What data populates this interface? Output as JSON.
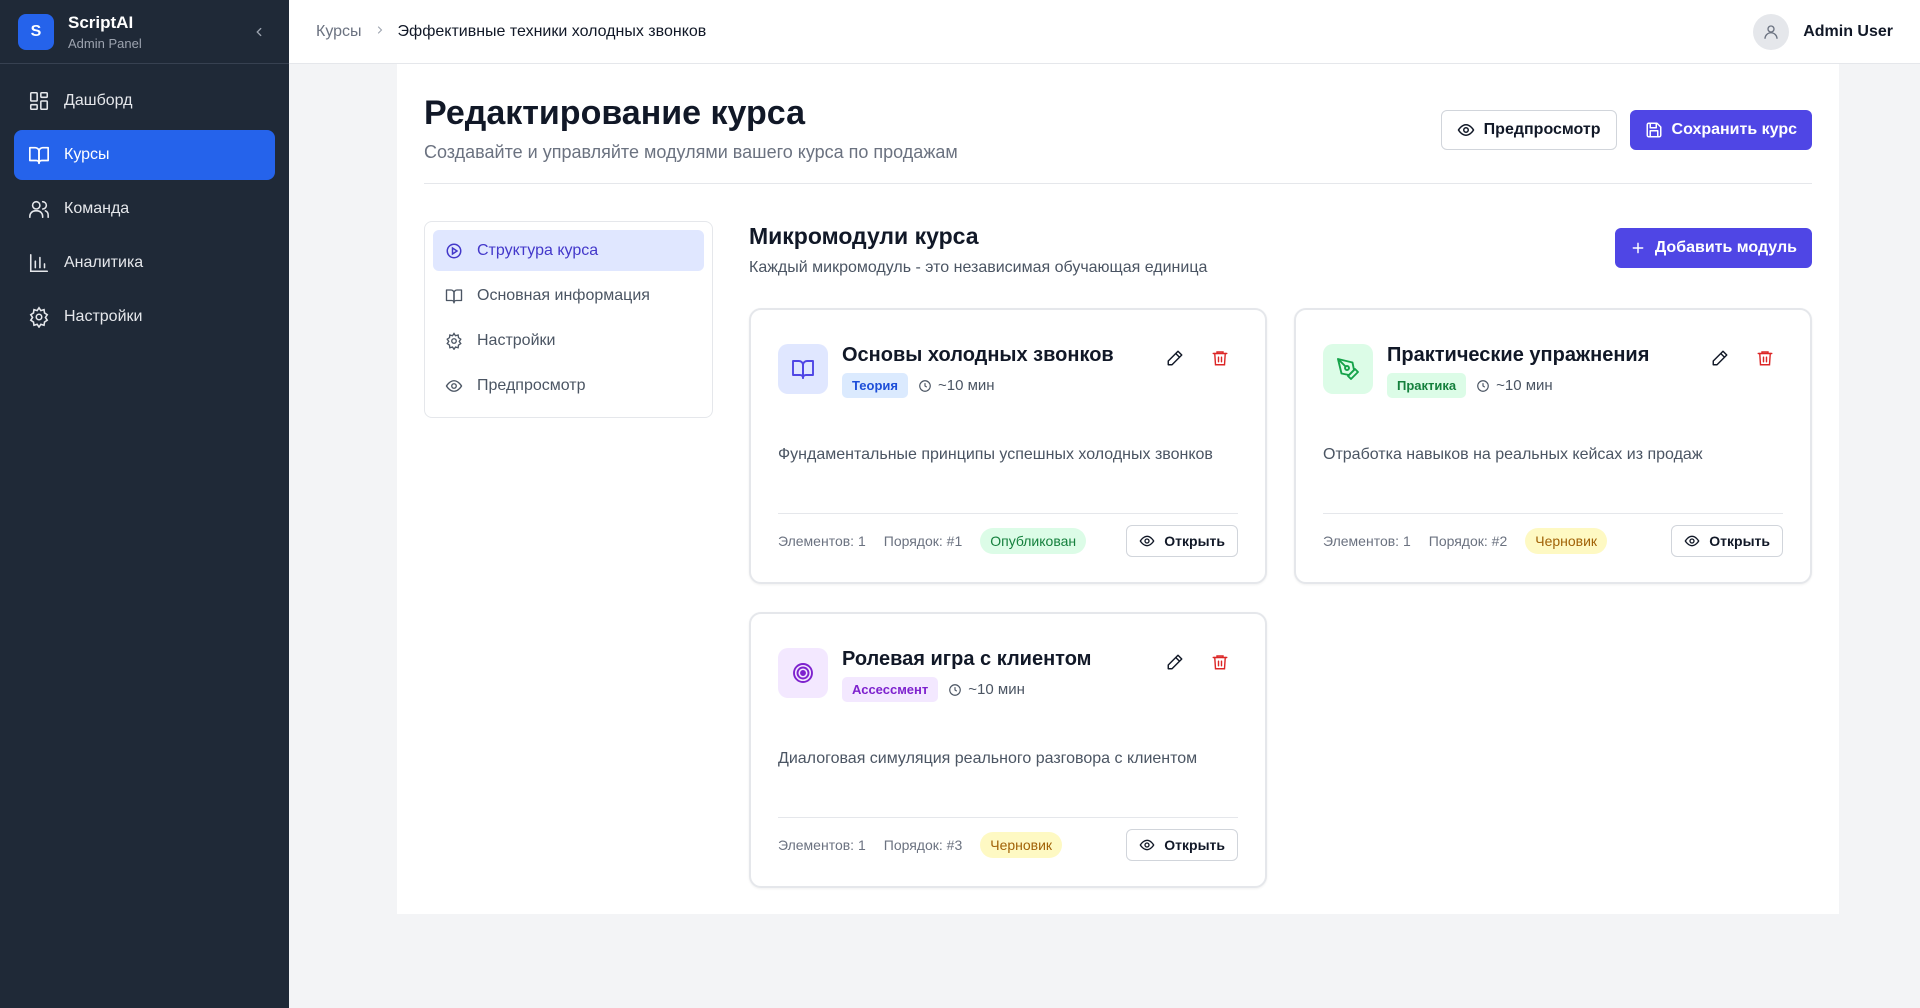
{
  "brand": {
    "logo_letter": "S",
    "title": "ScriptAI",
    "subtitle": "Admin Panel"
  },
  "sidebar": {
    "items": [
      {
        "label": "Дашборд",
        "icon": "dashboard-icon"
      },
      {
        "label": "Курсы",
        "icon": "book-icon",
        "active": true
      },
      {
        "label": "Команда",
        "icon": "users-icon"
      },
      {
        "label": "Аналитика",
        "icon": "chart-icon"
      },
      {
        "label": "Настройки",
        "icon": "gear-icon"
      }
    ]
  },
  "topbar": {
    "breadcrumb_root": "Курсы",
    "breadcrumb_current": "Эффективные техники холодных звонков",
    "user_name": "Admin User"
  },
  "page": {
    "title": "Редактирование курса",
    "subtitle": "Создавайте и управляйте модулями вашего курса по продажам",
    "preview_label": "Предпросмотр",
    "save_label": "Сохранить курс"
  },
  "tabs": [
    {
      "label": "Структура курса",
      "icon": "play-circle-icon",
      "active": true
    },
    {
      "label": "Основная информация",
      "icon": "book-icon"
    },
    {
      "label": "Настройки",
      "icon": "gear-icon"
    },
    {
      "label": "Предпросмотр",
      "icon": "eye-icon"
    }
  ],
  "modules_section": {
    "title": "Микромодули курса",
    "subtitle": "Каждый микромодуль - это независимая обучающая единица",
    "add_label": "Добавить модуль"
  },
  "modules": [
    {
      "title": "Основы холодных звонков",
      "tag": "Теория",
      "duration": "~10 мин",
      "description": "Фундаментальные принципы успешных холодных звонков",
      "elements": "Элементов: 1",
      "order": "Порядок: #1",
      "status": "Опубликован",
      "open_label": "Открыть",
      "icon": "book-open-icon",
      "colors": {
        "icon_bg": "#e0e7ff",
        "icon": "#4f46e5",
        "tag_bg": "#dbeafe",
        "tag_fg": "#1d4ed8",
        "status_bg": "#dcfce7",
        "status_fg": "#15803d"
      }
    },
    {
      "title": "Практические упражнения",
      "tag": "Практика",
      "duration": "~10 мин",
      "description": "Отработка навыков на реальных кейсах из продаж",
      "elements": "Элементов: 1",
      "order": "Порядок: #2",
      "status": "Черновик",
      "open_label": "Открыть",
      "icon": "pen-tool-icon",
      "colors": {
        "icon_bg": "#dcfce7",
        "icon": "#16a34a",
        "tag_bg": "#dcfce7",
        "tag_fg": "#15803d",
        "status_bg": "#fef9c3",
        "status_fg": "#a16207"
      }
    },
    {
      "title": "Ролевая игра с клиентом",
      "tag": "Ассессмент",
      "duration": "~10 мин",
      "description": "Диалоговая симуляция реального разговора с клиентом",
      "elements": "Элементов: 1",
      "order": "Порядок: #3",
      "status": "Черновик",
      "open_label": "Открыть",
      "icon": "target-icon",
      "colors": {
        "icon_bg": "#f3e8ff",
        "icon": "#7e22ce",
        "tag_bg": "#f3e8ff",
        "tag_fg": "#7e22ce",
        "status_bg": "#fef9c3",
        "status_fg": "#a16207"
      }
    }
  ]
}
